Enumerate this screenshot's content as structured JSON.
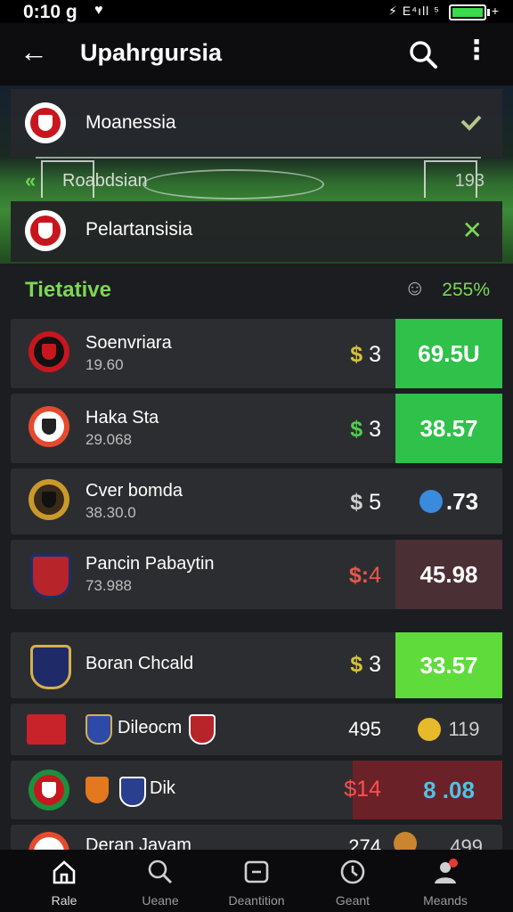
{
  "status": {
    "time": "0:10 g",
    "signal_text": "⚡ E⁴ıll ⁵",
    "battery_plus": "+"
  },
  "header": {
    "title": "Upahrgursia"
  },
  "competitions": [
    {
      "label": "Moanessia"
    },
    {
      "label": "Roabdsian",
      "right": "193"
    },
    {
      "label": "Pelartansisia"
    }
  ],
  "section": {
    "title": "Tietative",
    "count": "255%"
  },
  "rows": [
    {
      "name": "Soenvriara",
      "sub": "19.60",
      "price_symbol": "$",
      "price_value": "3",
      "odds": "69.5U"
    },
    {
      "name": "Haka Sta",
      "sub": "29.068",
      "price_symbol": "$",
      "price_value": "3",
      "odds": "38.57"
    },
    {
      "name": "Cver bomda",
      "sub": "38.30.0",
      "price_symbol": "$",
      "price_value": "5",
      "odds": ".73"
    },
    {
      "name": "Pancin Pabaytin",
      "sub": "73.988",
      "price_symbol": "$:",
      "price_value": "4",
      "odds": "45.98"
    },
    {
      "name": "Boran Chcald",
      "price_symbol": "$",
      "price_value": "3",
      "odds": "33.57"
    },
    {
      "name": "Dileocm",
      "price": "495",
      "odds": "119"
    },
    {
      "name": "Dik",
      "price": "$14",
      "odds": "8 .08"
    },
    {
      "name": "Deran Javam",
      "price": "274",
      "odds": "499"
    }
  ],
  "nav": [
    {
      "label": "Rale"
    },
    {
      "label": "Ueane"
    },
    {
      "label": "Deantition"
    },
    {
      "label": "Geant"
    },
    {
      "label": "Meands"
    }
  ],
  "colors": {
    "green": "#2fc14a",
    "green_light": "#5fdc3c",
    "red_row": "#4a2f35",
    "accent_green": "#7dd656"
  }
}
